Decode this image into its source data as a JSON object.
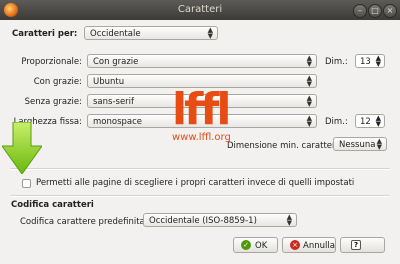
{
  "window": {
    "title": "Caratteri"
  },
  "fonts_for": {
    "label": "Caratteri per:",
    "value": "Occidentale"
  },
  "proportional": {
    "label": "Proporzionale:",
    "value": "Con grazie",
    "size_label": "Dim.:",
    "size": "13"
  },
  "serif": {
    "label": "Con grazie:",
    "value": "Ubuntu"
  },
  "sans": {
    "label": "Senza grazie:",
    "value": "sans-serif"
  },
  "mono": {
    "label": "Larghezza fissa:",
    "value": "monospace",
    "size_label": "Dim.:",
    "size": "12"
  },
  "min_size": {
    "label": "Dimensione min. carattere:",
    "value": "Nessuna"
  },
  "allow_pages": {
    "label": "Permetti alle pagine di scegliere i propri caratteri invece di quelli impostati",
    "checked": false
  },
  "encoding": {
    "section": "Codifica caratteri",
    "label": "Codifica carattere predefinita:",
    "value": "Occidentale (ISO-8859-1)"
  },
  "buttons": {
    "ok": "OK",
    "cancel": "Annulla"
  },
  "watermark": {
    "logo": "lffl",
    "url": "www.lffl.org"
  },
  "icons": {
    "app": "firefox-icon",
    "arrow": "green-down-arrow-icon",
    "help": "help-icon"
  }
}
